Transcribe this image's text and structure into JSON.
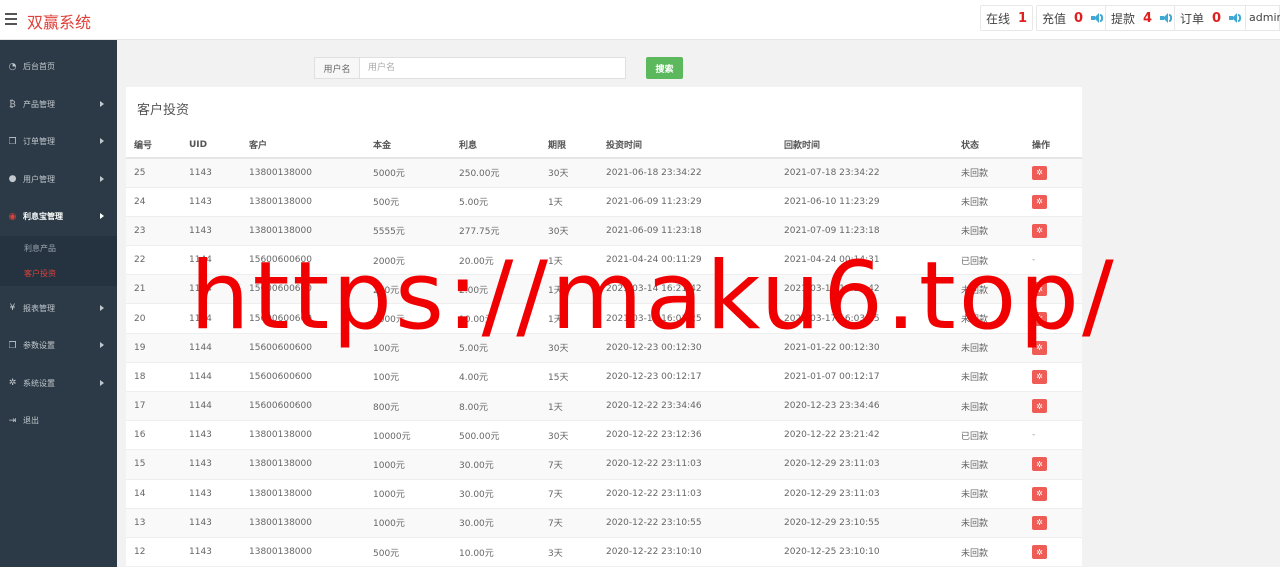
{
  "header": {
    "logo": "双赢系统",
    "stats": [
      {
        "label": "在线",
        "value": "1"
      },
      {
        "label": "充值",
        "value": "0"
      },
      {
        "label": "提款",
        "value": "4"
      },
      {
        "label": "订单",
        "value": "0"
      }
    ],
    "admin": "admin"
  },
  "sidebar": {
    "items": [
      {
        "label": "后台首页",
        "icon": "dashboard-icon"
      },
      {
        "label": "产品管理",
        "icon": "bitcoin-icon"
      },
      {
        "label": "订单管理",
        "icon": "copy-icon"
      },
      {
        "label": "用户管理",
        "icon": "user-icon"
      },
      {
        "label": "利息宝管理",
        "icon": "lifebuoy-icon"
      },
      {
        "label": "报表管理",
        "icon": "yen-icon"
      },
      {
        "label": "参数设置",
        "icon": "copy-icon"
      },
      {
        "label": "系统设置",
        "icon": "gears-icon"
      },
      {
        "label": "退出",
        "icon": "sign-out-icon"
      }
    ],
    "submenu": [
      "利息产品",
      "客户投资"
    ]
  },
  "search": {
    "label": "用户名",
    "placeholder": "用户名",
    "button": "搜索"
  },
  "panel": {
    "title": "客户投资",
    "columns": [
      "编号",
      "UID",
      "客户",
      "本金",
      "利息",
      "期限",
      "投资时间",
      "回款时间",
      "状态",
      "操作"
    ],
    "rows": [
      [
        "25",
        "1143",
        "13800138000",
        "5000元",
        "250.00元",
        "30天",
        "2021-06-18 23:34:22",
        "2021-07-18 23:34:22",
        "未回款",
        "btn"
      ],
      [
        "24",
        "1143",
        "13800138000",
        "500元",
        "5.00元",
        "1天",
        "2021-06-09 11:23:29",
        "2021-06-10 11:23:29",
        "未回款",
        "btn"
      ],
      [
        "23",
        "1143",
        "13800138000",
        "5555元",
        "277.75元",
        "30天",
        "2021-06-09 11:23:18",
        "2021-07-09 11:23:18",
        "未回款",
        "btn"
      ],
      [
        "22",
        "1144",
        "15600600600",
        "2000元",
        "20.00元",
        "1天",
        "2021-04-24 00:11:29",
        "2021-04-24 00:14:31",
        "已回款",
        "-"
      ],
      [
        "21",
        "1144",
        "15600600600",
        "200元",
        "2.00元",
        "1天",
        "2021-03-14 16:21:42",
        "2021-03-15 16:21:42",
        "未回款",
        "btn"
      ],
      [
        "20",
        "1144",
        "15600600600",
        "1000元",
        "10.00元",
        "1天",
        "2021-03-14 16:03:25",
        "2021-03-17 16:03:25",
        "未回款",
        "btn"
      ],
      [
        "19",
        "1144",
        "15600600600",
        "100元",
        "5.00元",
        "30天",
        "2020-12-23 00:12:30",
        "2021-01-22 00:12:30",
        "未回款",
        "btn"
      ],
      [
        "18",
        "1144",
        "15600600600",
        "100元",
        "4.00元",
        "15天",
        "2020-12-23 00:12:17",
        "2021-01-07 00:12:17",
        "未回款",
        "btn"
      ],
      [
        "17",
        "1144",
        "15600600600",
        "800元",
        "8.00元",
        "1天",
        "2020-12-22 23:34:46",
        "2020-12-23 23:34:46",
        "未回款",
        "btn"
      ],
      [
        "16",
        "1143",
        "13800138000",
        "10000元",
        "500.00元",
        "30天",
        "2020-12-22 23:12:36",
        "2020-12-22 23:21:42",
        "已回款",
        "-"
      ],
      [
        "15",
        "1143",
        "13800138000",
        "1000元",
        "30.00元",
        "7天",
        "2020-12-22 23:11:03",
        "2020-12-29 23:11:03",
        "未回款",
        "btn"
      ],
      [
        "14",
        "1143",
        "13800138000",
        "1000元",
        "30.00元",
        "7天",
        "2020-12-22 23:11:03",
        "2020-12-29 23:11:03",
        "未回款",
        "btn"
      ],
      [
        "13",
        "1143",
        "13800138000",
        "1000元",
        "30.00元",
        "7天",
        "2020-12-22 23:10:55",
        "2020-12-29 23:10:55",
        "未回款",
        "btn"
      ],
      [
        "12",
        "1143",
        "13800138000",
        "500元",
        "10.00元",
        "3天",
        "2020-12-22 23:10:10",
        "2020-12-25 23:10:10",
        "未回款",
        "btn"
      ]
    ]
  },
  "watermark": "https://maku6.top/"
}
